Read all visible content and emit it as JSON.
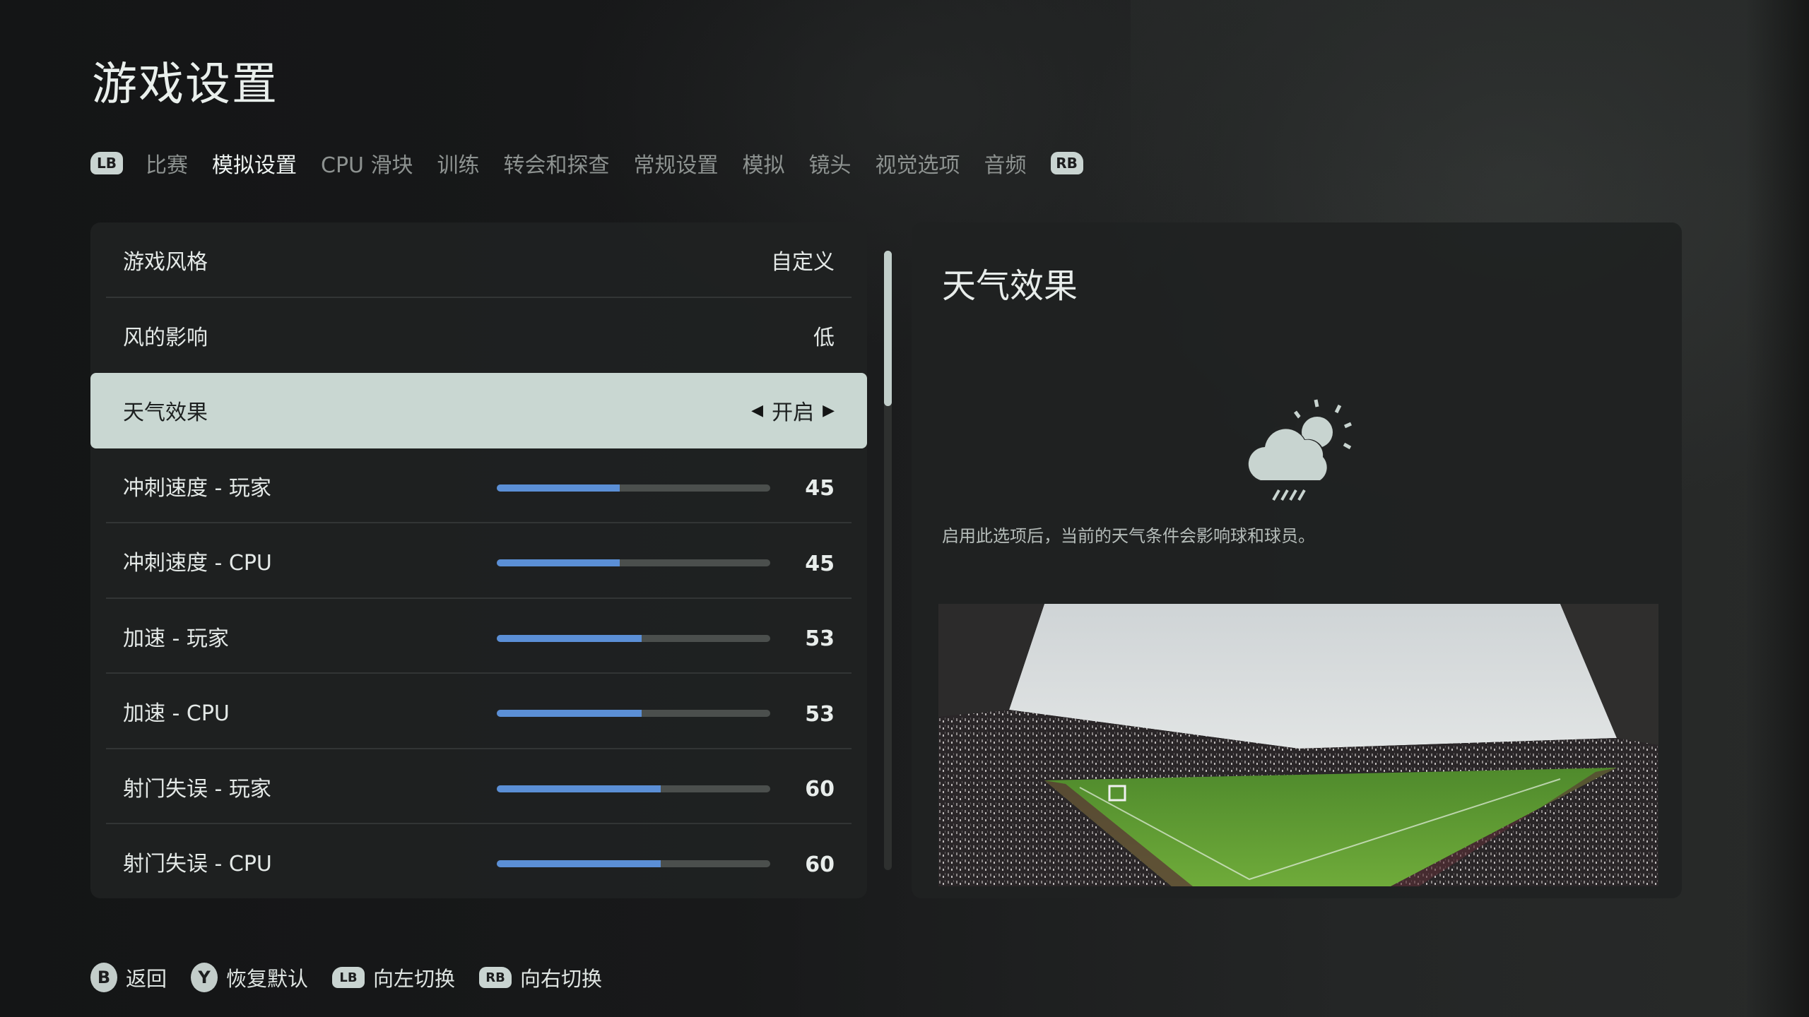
{
  "page": {
    "title": "游戏设置"
  },
  "tabs": {
    "left_bumper": "LB",
    "right_bumper": "RB",
    "items": [
      {
        "label": "比赛",
        "active": false
      },
      {
        "label": "模拟设置",
        "active": true
      },
      {
        "label": "CPU 滑块",
        "active": false
      },
      {
        "label": "训练",
        "active": false
      },
      {
        "label": "转会和探查",
        "active": false
      },
      {
        "label": "常规设置",
        "active": false
      },
      {
        "label": "模拟",
        "active": false
      },
      {
        "label": "镜头",
        "active": false
      },
      {
        "label": "视觉选项",
        "active": false
      },
      {
        "label": "音频",
        "active": false
      }
    ]
  },
  "settings": {
    "options": [
      {
        "label": "游戏风格",
        "value": "自定义"
      },
      {
        "label": "风的影响",
        "value": "低"
      },
      {
        "label": "天气效果",
        "value": "开启",
        "selected": true
      }
    ],
    "sliders": [
      {
        "label": "冲刺速度 - 玩家",
        "value": 45,
        "max": 100
      },
      {
        "label": "冲刺速度 - CPU",
        "value": 45,
        "max": 100
      },
      {
        "label": "加速 - 玩家",
        "value": 53,
        "max": 100
      },
      {
        "label": "加速 - CPU",
        "value": 53,
        "max": 100
      },
      {
        "label": "射门失误 - 玩家",
        "value": 60,
        "max": 100
      },
      {
        "label": "射门失误 - CPU",
        "value": 60,
        "max": 100
      }
    ],
    "scroll_position": 0.0
  },
  "detail": {
    "title": "天气效果",
    "icon": "weather-rain-sun-icon",
    "description": "启用此选项后，当前的天气条件会影响球和球员。",
    "preview_image": "stadium-preview"
  },
  "footer": {
    "hints": [
      {
        "button": "B",
        "label": "返回"
      },
      {
        "button": "Y",
        "label": "恢复默认"
      },
      {
        "button": "LB",
        "label": "向左切换"
      },
      {
        "button": "RB",
        "label": "向右切换"
      }
    ]
  },
  "colors": {
    "accent_blue": "#5b8fd6",
    "selected_row": "#c9d7d2",
    "track": "#4b4f4d"
  }
}
